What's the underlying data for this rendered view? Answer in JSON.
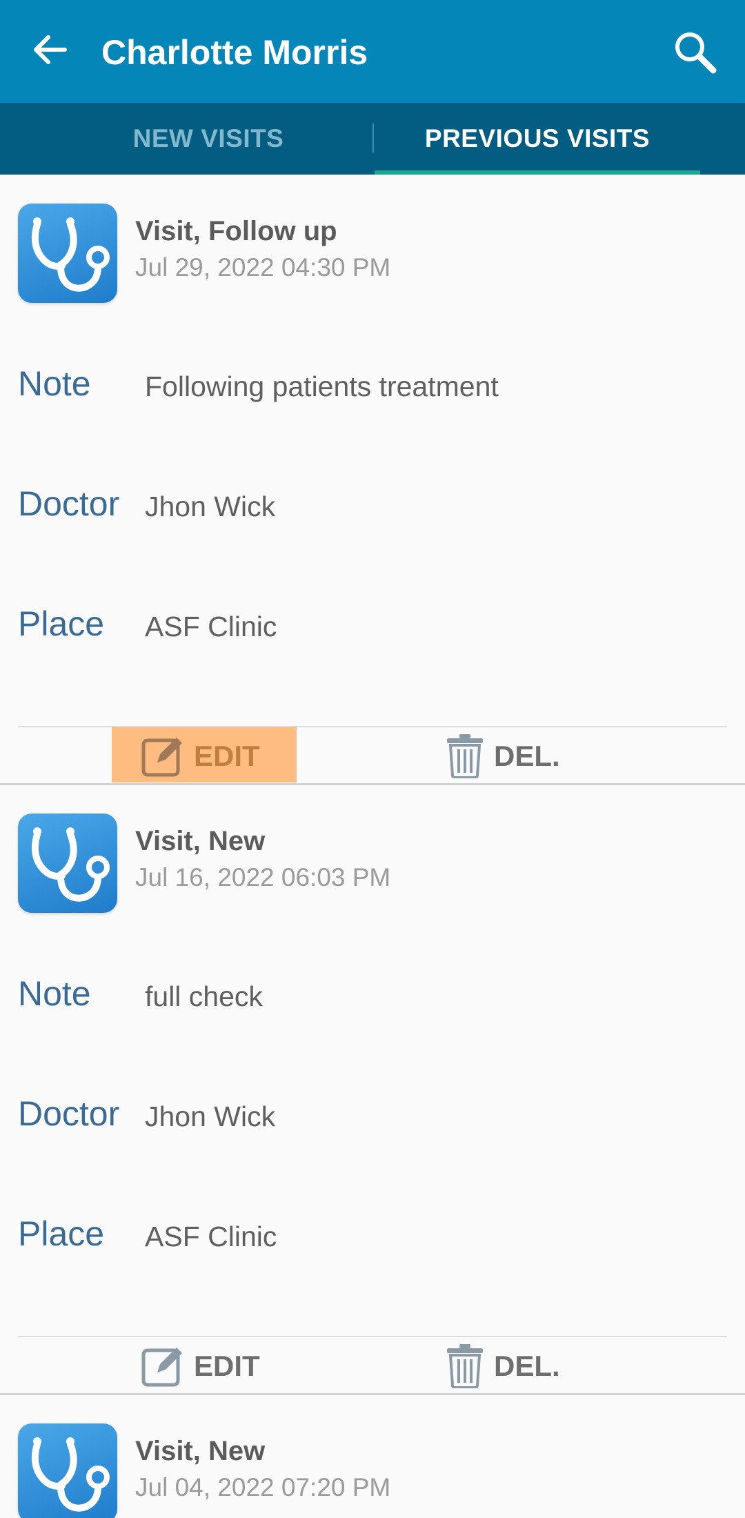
{
  "header": {
    "title": "Charlotte Morris",
    "back_icon": "arrow-left-icon",
    "search_icon": "search-icon",
    "background_color": "#0487b8"
  },
  "tabs": {
    "new_visits": "NEW VISITS",
    "previous_visits": "PREVIOUS VISITS",
    "selected": "previous_visits",
    "background_color": "#035d82",
    "indicator_color": "#18a890"
  },
  "labels": {
    "note": "Note",
    "doctor": "Doctor",
    "place": "Place",
    "edit": "EDIT",
    "delete": "DEL."
  },
  "visits": [
    {
      "type": "Visit, Follow up",
      "date": "Jul 29, 2022 04:30 PM",
      "note": "Following patients treatment",
      "doctor": "Jhon Wick",
      "place": "ASF Clinic",
      "icon": "stethoscope-icon",
      "edit_highlighted": true
    },
    {
      "type": "Visit, New",
      "date": "Jul 16, 2022 06:03 PM",
      "note": "full check",
      "doctor": "Jhon Wick",
      "place": "ASF Clinic",
      "icon": "stethoscope-icon",
      "edit_highlighted": false
    },
    {
      "type": "Visit, New",
      "date": "Jul 04, 2022 07:20 PM",
      "icon": "stethoscope-icon"
    }
  ],
  "colors": {
    "label_blue": "#3a6a96",
    "edit_highlight": "#ffbc80",
    "icon_blue": "#2a88d8"
  }
}
